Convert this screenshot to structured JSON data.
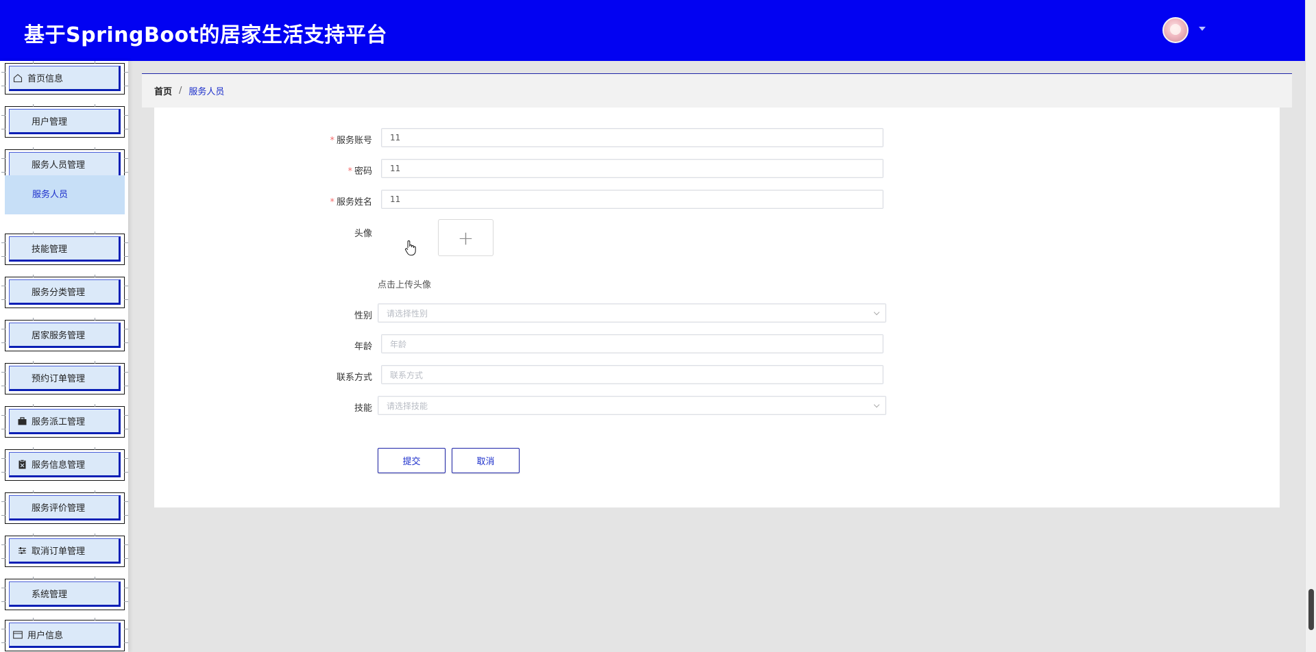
{
  "header": {
    "title": "基于SpringBoot的居家生活支持平台",
    "avatar_icon": "user-avatar",
    "dropdown_icon": "caret-down-icon"
  },
  "sidebar": {
    "items": [
      {
        "label": "首页信息",
        "icon": "home-icon"
      },
      {
        "label": "用户管理",
        "icon": "grid-icon"
      },
      {
        "label": "服务人员管理",
        "icon": "grid-icon"
      },
      {
        "label": "技能管理",
        "icon": "grid-icon"
      },
      {
        "label": "服务分类管理",
        "icon": "grid-icon"
      },
      {
        "label": "居家服务管理",
        "icon": "grid-icon"
      },
      {
        "label": "预约订单管理",
        "icon": "grid-icon"
      },
      {
        "label": "服务派工管理",
        "icon": "briefcase-icon"
      },
      {
        "label": "服务信息管理",
        "icon": "clipboard-icon"
      },
      {
        "label": "服务评价管理",
        "icon": "grid-icon"
      },
      {
        "label": "取消订单管理",
        "icon": "sliders-icon"
      },
      {
        "label": "系统管理",
        "icon": "grid-icon"
      },
      {
        "label": "用户信息",
        "icon": "card-icon"
      }
    ],
    "submenu": {
      "label": "服务人员"
    }
  },
  "breadcrumb": {
    "home": "首页",
    "separator": "/",
    "current": "服务人员"
  },
  "form": {
    "account": {
      "label": "服务账号",
      "value": "11"
    },
    "password": {
      "label": "密码",
      "value": "11"
    },
    "name": {
      "label": "服务姓名",
      "value": "11"
    },
    "avatar": {
      "label": "头像",
      "upload_symbol": "+",
      "hint": "点击上传头像"
    },
    "gender": {
      "label": "性别",
      "placeholder": "请选择性别"
    },
    "age": {
      "label": "年龄",
      "placeholder": "年龄"
    },
    "contact": {
      "label": "联系方式",
      "placeholder": "联系方式"
    },
    "skill": {
      "label": "技能",
      "placeholder": "请选择技能"
    },
    "required_mark": "*"
  },
  "buttons": {
    "submit": "提交",
    "cancel": "取消"
  },
  "colors": {
    "header": "#0202f2",
    "accent": "#1c2fcb",
    "required": "#f56c6c"
  }
}
